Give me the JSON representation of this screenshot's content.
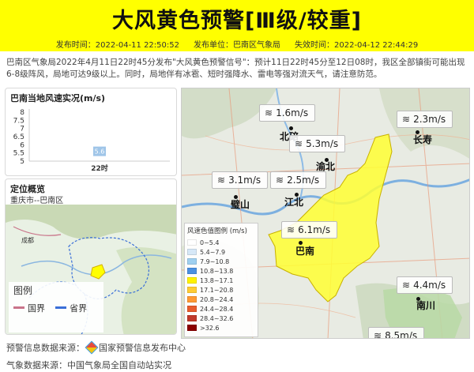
{
  "header": {
    "title": "大风黄色预警[Ⅲ级/较重]",
    "issue_time": "发布时间：2022-04-11 22:50:52",
    "issuer": "发布单位：巴南区气象局",
    "expire_time": "失效时间：2022-04-12 22:44:29",
    "bg_color": "#ffff00"
  },
  "description": "巴南区气象局2022年4月11日22时45分发布\"大风黄色预警信号\"：预计11日22时45分至12日08时，我区全部镇街可能出现6-8级阵风，局地可达9级以上。同时，局地伴有冰雹、短时强降水、雷电等强对流天气，请注意防范。",
  "wind_chart": {
    "title": "巴南当地风速实况(m/s)"
  },
  "chart_data": {
    "type": "scatter",
    "title": "巴南当地风速实况(m/s)",
    "categories": [
      "22时"
    ],
    "values": [
      5.6
    ],
    "data_labels": [
      "5.6"
    ],
    "yticks": [
      "8",
      "7.5",
      "7",
      "6.5",
      "6",
      "5.5",
      "5"
    ],
    "ylim": [
      5,
      8
    ],
    "grid": false
  },
  "overview": {
    "title": "定位概览",
    "subtitle": "重庆市--巴南区",
    "map_labels": [
      "成都"
    ],
    "legend_title": "图例",
    "legend_items": [
      {
        "label": "国界",
        "color": "#c9748a"
      },
      {
        "label": "省界",
        "color": "#3a6fd8"
      }
    ]
  },
  "map": {
    "stations": [
      {
        "value": "1.6m/s"
      },
      {
        "value": "2.3m/s"
      },
      {
        "value": "5.3m/s"
      },
      {
        "value": "3.1m/s"
      },
      {
        "value": "2.5m/s"
      },
      {
        "value": "6.1m/s"
      },
      {
        "value": "4.4m/s"
      },
      {
        "value": "8.5m/s"
      }
    ],
    "cities": [
      "北碚",
      "长寿",
      "渝北",
      "璧山",
      "江北",
      "巴南",
      "南川"
    ],
    "wind_icon": "wind-icon",
    "legend": {
      "title": "风速色值图例 (m/s)",
      "items": [
        {
          "label": "0~5.4",
          "color": "#ffffff"
        },
        {
          "label": "5.4~7.9",
          "color": "#d6e8f7"
        },
        {
          "label": "7.9~10.8",
          "color": "#9fd0f0"
        },
        {
          "label": "10.8~13.8",
          "color": "#4a90e2"
        },
        {
          "label": "13.8~17.1",
          "color": "#fff200"
        },
        {
          "label": "17.1~20.8",
          "color": "#ffcc33"
        },
        {
          "label": "20.8~24.4",
          "color": "#ff9933"
        },
        {
          "label": "24.4~28.4",
          "color": "#e85c2c"
        },
        {
          "label": "28.4~32.6",
          "color": "#c0392b"
        },
        {
          "label": ">32.6",
          "color": "#8b0000"
        }
      ]
    }
  },
  "footer": {
    "warning_source": "预警信息数据来源：",
    "warning_source_name": "国家预警信息发布中心",
    "weather_source": "气象数据来源：中国气象局全国自动站实况"
  }
}
